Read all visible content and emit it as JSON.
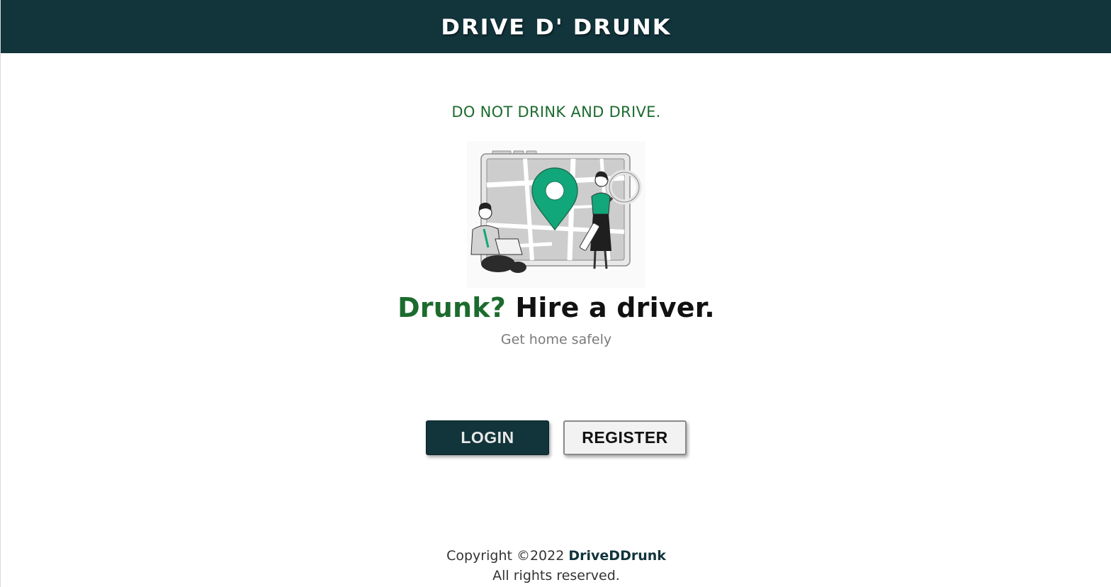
{
  "header": {
    "brand": "DRIVE D' DRUNK",
    "background_color": "#12343b"
  },
  "main": {
    "slogan": "DO NOT DRINK AND DRIVE.",
    "illustration": "map-pin-people-illustration",
    "headline_accent": "Drunk?",
    "headline_rest": "Hire a driver.",
    "subheadline": "Get home safely",
    "accent_color": "#1c6b2e"
  },
  "actions": {
    "login_label": "LOGIN",
    "register_label": "REGISTER"
  },
  "footer": {
    "copyright_prefix": "Copyright ©2022",
    "copyright_brand": "DriveDDrunk",
    "rights": "All rights reserved."
  }
}
